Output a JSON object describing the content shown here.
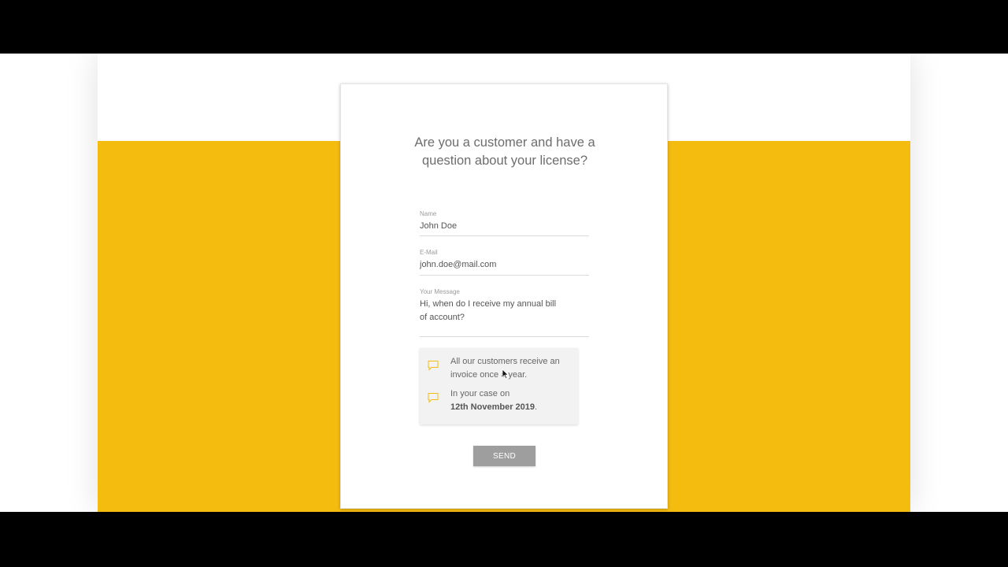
{
  "form": {
    "title": "Are you a customer and have a question about your license?",
    "name": {
      "label": "Name",
      "value": "John Doe"
    },
    "email": {
      "label": "E-Mail",
      "value": "john.doe@mail.com"
    },
    "message": {
      "label": "Your Message",
      "value": "Hi, when do I receive my annual bill of account?"
    },
    "send_label": "SEND"
  },
  "chat": {
    "items": [
      {
        "text": "All our customers receive an invoice once a year.",
        "icon": "chat-bubble-icon"
      },
      {
        "text_prefix": "In your case on",
        "text_bold": "12th November 2019",
        "text_suffix": ".",
        "icon": "chat-bubble-icon"
      }
    ]
  },
  "colors": {
    "accent": "#f5bc10",
    "button": "#9e9e9e"
  }
}
